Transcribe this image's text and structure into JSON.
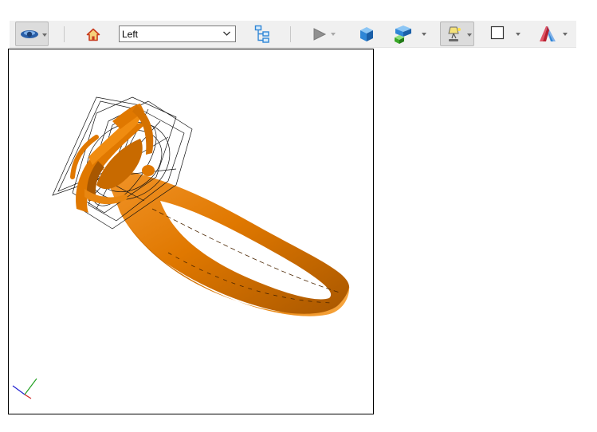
{
  "toolbar": {
    "view_select": {
      "value": "Left",
      "options": [
        "Left"
      ]
    },
    "icons": {
      "navigation": "navigation-mode-icon",
      "home": "home-icon",
      "tree": "model-tree-icon",
      "animation": "play-icon",
      "shaded": "shaded-cube-icon",
      "explode": "explode-parts-icon",
      "lighting": "lighting-lamp-icon",
      "background": "background-color-icon",
      "cross_section": "cross-section-icon"
    },
    "colors": {
      "home": "#c83c1e",
      "cube": "#2f86d6",
      "explode_green": "#3aa829",
      "cross_section": "#b82030"
    }
  },
  "viewport": {
    "model": "ring-model",
    "colors": {
      "ring": "#e07800",
      "ring_highlight": "#f7a640",
      "ring_shadow": "#8a4500",
      "wireframe": "#111111"
    },
    "axis_triad": {
      "x_color": "#d02020",
      "y_color": "#20a020",
      "z_color": "#2020d0"
    }
  }
}
